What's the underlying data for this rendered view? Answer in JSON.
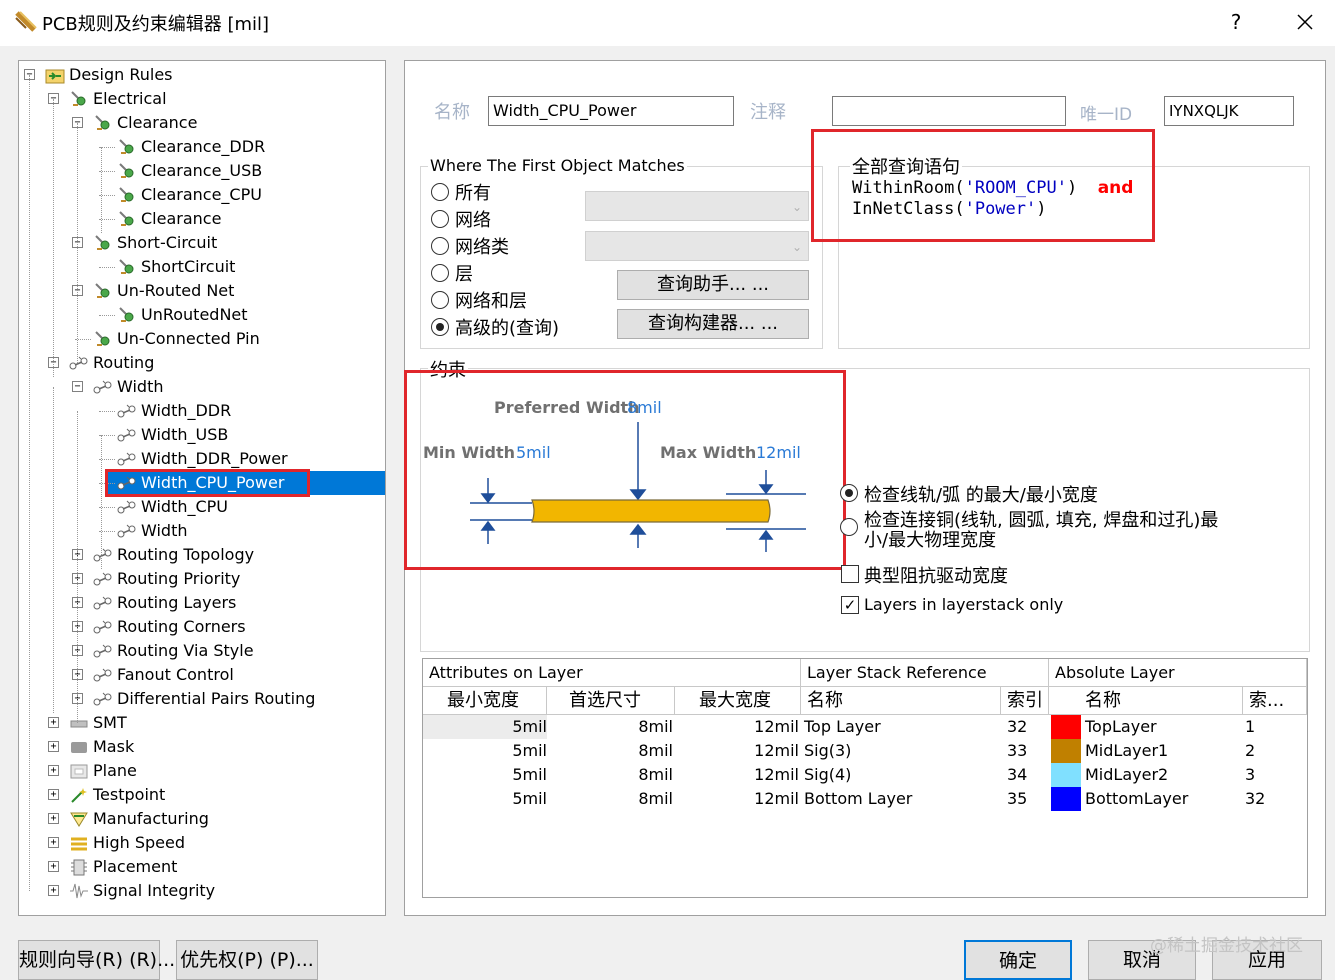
{
  "window": {
    "title": "PCB规则及约束编辑器 [mil]",
    "help": "?"
  },
  "tree": {
    "items": [
      {
        "label": "Design Rules"
      },
      {
        "label": "Electrical"
      },
      {
        "label": "Clearance"
      },
      {
        "label": "Clearance_DDR"
      },
      {
        "label": "Clearance_USB"
      },
      {
        "label": "Clearance_CPU"
      },
      {
        "label": "Clearance"
      },
      {
        "label": "Short-Circuit"
      },
      {
        "label": "ShortCircuit"
      },
      {
        "label": "Un-Routed Net"
      },
      {
        "label": "UnRoutedNet"
      },
      {
        "label": "Un-Connected Pin"
      },
      {
        "label": "Routing"
      },
      {
        "label": "Width"
      },
      {
        "label": "Width_DDR"
      },
      {
        "label": "Width_USB"
      },
      {
        "label": "Width_DDR_Power"
      },
      {
        "label": "Width_CPU_Power"
      },
      {
        "label": "Width_CPU"
      },
      {
        "label": "Width"
      },
      {
        "label": "Routing Topology"
      },
      {
        "label": "Routing Priority"
      },
      {
        "label": "Routing Layers"
      },
      {
        "label": "Routing Corners"
      },
      {
        "label": "Routing Via Style"
      },
      {
        "label": "Fanout Control"
      },
      {
        "label": "Differential Pairs Routing"
      },
      {
        "label": "SMT"
      },
      {
        "label": "Mask"
      },
      {
        "label": "Plane"
      },
      {
        "label": "Testpoint"
      },
      {
        "label": "Manufacturing"
      },
      {
        "label": "High Speed"
      },
      {
        "label": "Placement"
      },
      {
        "label": "Signal Integrity"
      }
    ]
  },
  "rule": {
    "name_label": "名称",
    "name_value": "Width_CPU_Power",
    "comment_label": "注释",
    "comment_value": "",
    "uid_label": "唯一ID",
    "uid_value": "IYNXQLJK"
  },
  "match": {
    "title": "Where The First Object Matches",
    "options": [
      "所有",
      "网络",
      "网络类",
      "层",
      "网络和层",
      "高级的(查询)"
    ],
    "query_helper_btn": "查询助手... ...",
    "query_builder_btn": "查询构建器... ..."
  },
  "query": {
    "title": "全部查询语句",
    "line1_fn": "WithinRoom(",
    "line1_arg": "'ROOM_CPU'",
    "line1_close": ")",
    "line1_op": "and",
    "line2_fn": "InNetClass(",
    "line2_arg": "'Power'",
    "line2_close": ")"
  },
  "constraints": {
    "title": "约束",
    "preferred_label": "Preferred Width",
    "preferred_value": "8mil",
    "min_label": "Min Width",
    "min_value": "5mil",
    "max_label": "Max Width",
    "max_value": "12mil",
    "option1": "检查线轨/弧 的最大/最小宽度",
    "option2_line1": "检查连接铜(线轨, 圆弧, 填充, 焊盘和过孔)最",
    "option2_line2": "小/最大物理宽度",
    "checkbox1": "典型阻抗驱动宽度",
    "checkbox2": "Layers in layerstack only"
  },
  "table": {
    "group_headers": [
      "Attributes on Layer",
      "Layer Stack Reference",
      "Absolute Layer"
    ],
    "columns": [
      "最小宽度",
      "首选尺寸",
      "最大宽度",
      "名称",
      "索引",
      "名称",
      "索..."
    ],
    "rows": [
      {
        "min": "5mil",
        "pref": "8mil",
        "max": "12mil",
        "stack_name": "Top Layer",
        "stack_index": "32",
        "abs_name": "TopLayer",
        "abs_index": "1",
        "color": "#ff0000"
      },
      {
        "min": "5mil",
        "pref": "8mil",
        "max": "12mil",
        "stack_name": "Sig(3)",
        "stack_index": "33",
        "abs_name": "MidLayer1",
        "abs_index": "2",
        "color": "#c08000"
      },
      {
        "min": "5mil",
        "pref": "8mil",
        "max": "12mil",
        "stack_name": "Sig(4)",
        "stack_index": "34",
        "abs_name": "MidLayer2",
        "abs_index": "3",
        "color": "#80e0ff"
      },
      {
        "min": "5mil",
        "pref": "8mil",
        "max": "12mil",
        "stack_name": "Bottom Layer",
        "stack_index": "35",
        "abs_name": "BottomLayer",
        "abs_index": "32",
        "color": "#0000ff"
      }
    ]
  },
  "buttons": {
    "rule_wizard": "规则向导(R) (R)...",
    "priority": "优先权(P) (P)...",
    "ok": "确定",
    "cancel": "取消",
    "apply": "应用"
  },
  "watermark": "@稀土掘金技术社区",
  "colors": {
    "selection": "#0078d7",
    "highlight_box": "#e0262b",
    "query_string": "#0000c0",
    "query_and": "#ff0000",
    "value_blue": "#2a7ad6",
    "trace_fill": "#f2b600"
  }
}
